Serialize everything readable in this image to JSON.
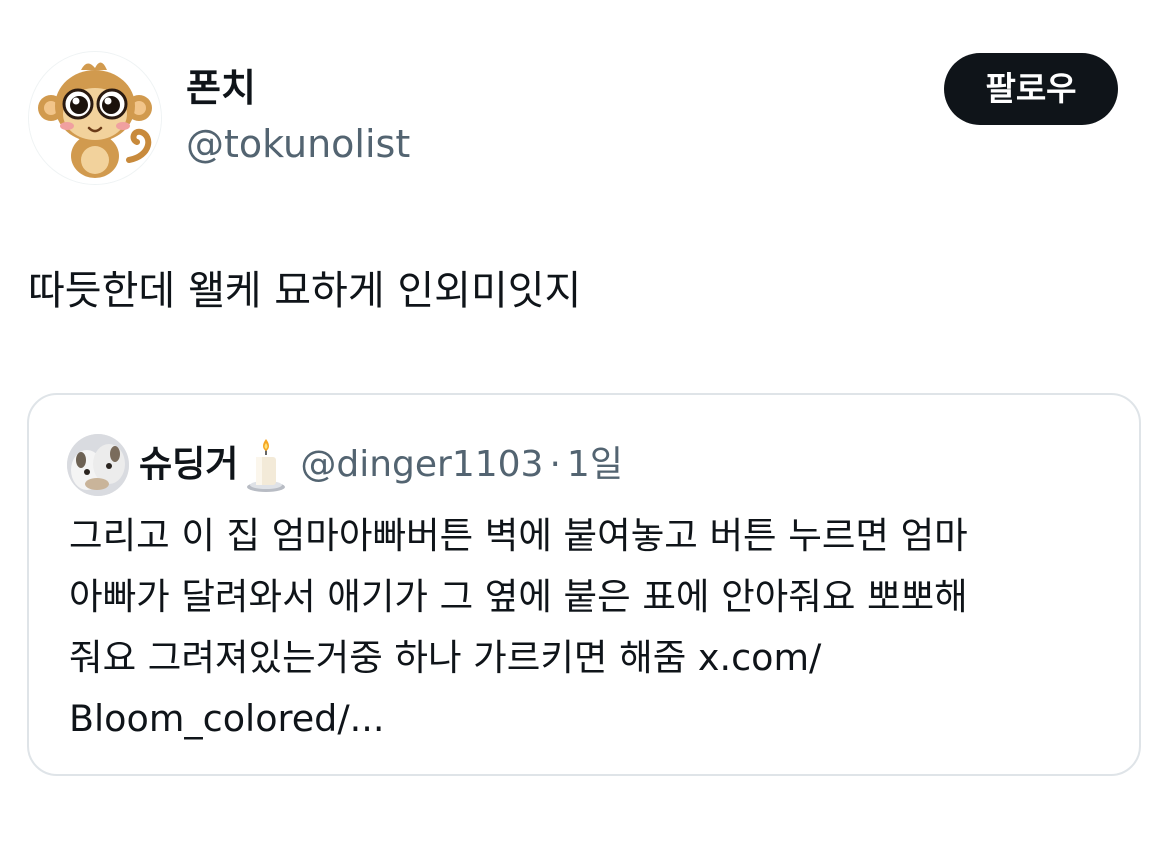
{
  "tweet": {
    "author": {
      "display_name": "폰치",
      "handle": "@tokunolist",
      "avatar_icon": "monkey-avatar"
    },
    "follow_label": "팔로우",
    "text": "따듯한데 왤케 묘하게 인외미잇지"
  },
  "quote": {
    "author": {
      "display_name": "슈딩거",
      "emoji_icon": "candle-icon",
      "handle": "@dinger1103",
      "separator": "·",
      "time": "1일",
      "avatar_icon": "puppy-avatar"
    },
    "text_lines": [
      "그리고 이 집 엄마아빠버튼 벽에 붙여놓고 버튼 누르면 엄마",
      "아빠가 달려와서 애기가 그 옆에 붙은 표에  안아줘요 뽀뽀해",
      "줘요 그려져있는거중 하나 가르키면 해줌 x.com/",
      "Bloom_colored/..."
    ]
  },
  "colors": {
    "text_primary": "#0f1419",
    "text_secondary": "#536471",
    "follow_bg": "#0f1419",
    "card_border": "#dfe4e8"
  }
}
